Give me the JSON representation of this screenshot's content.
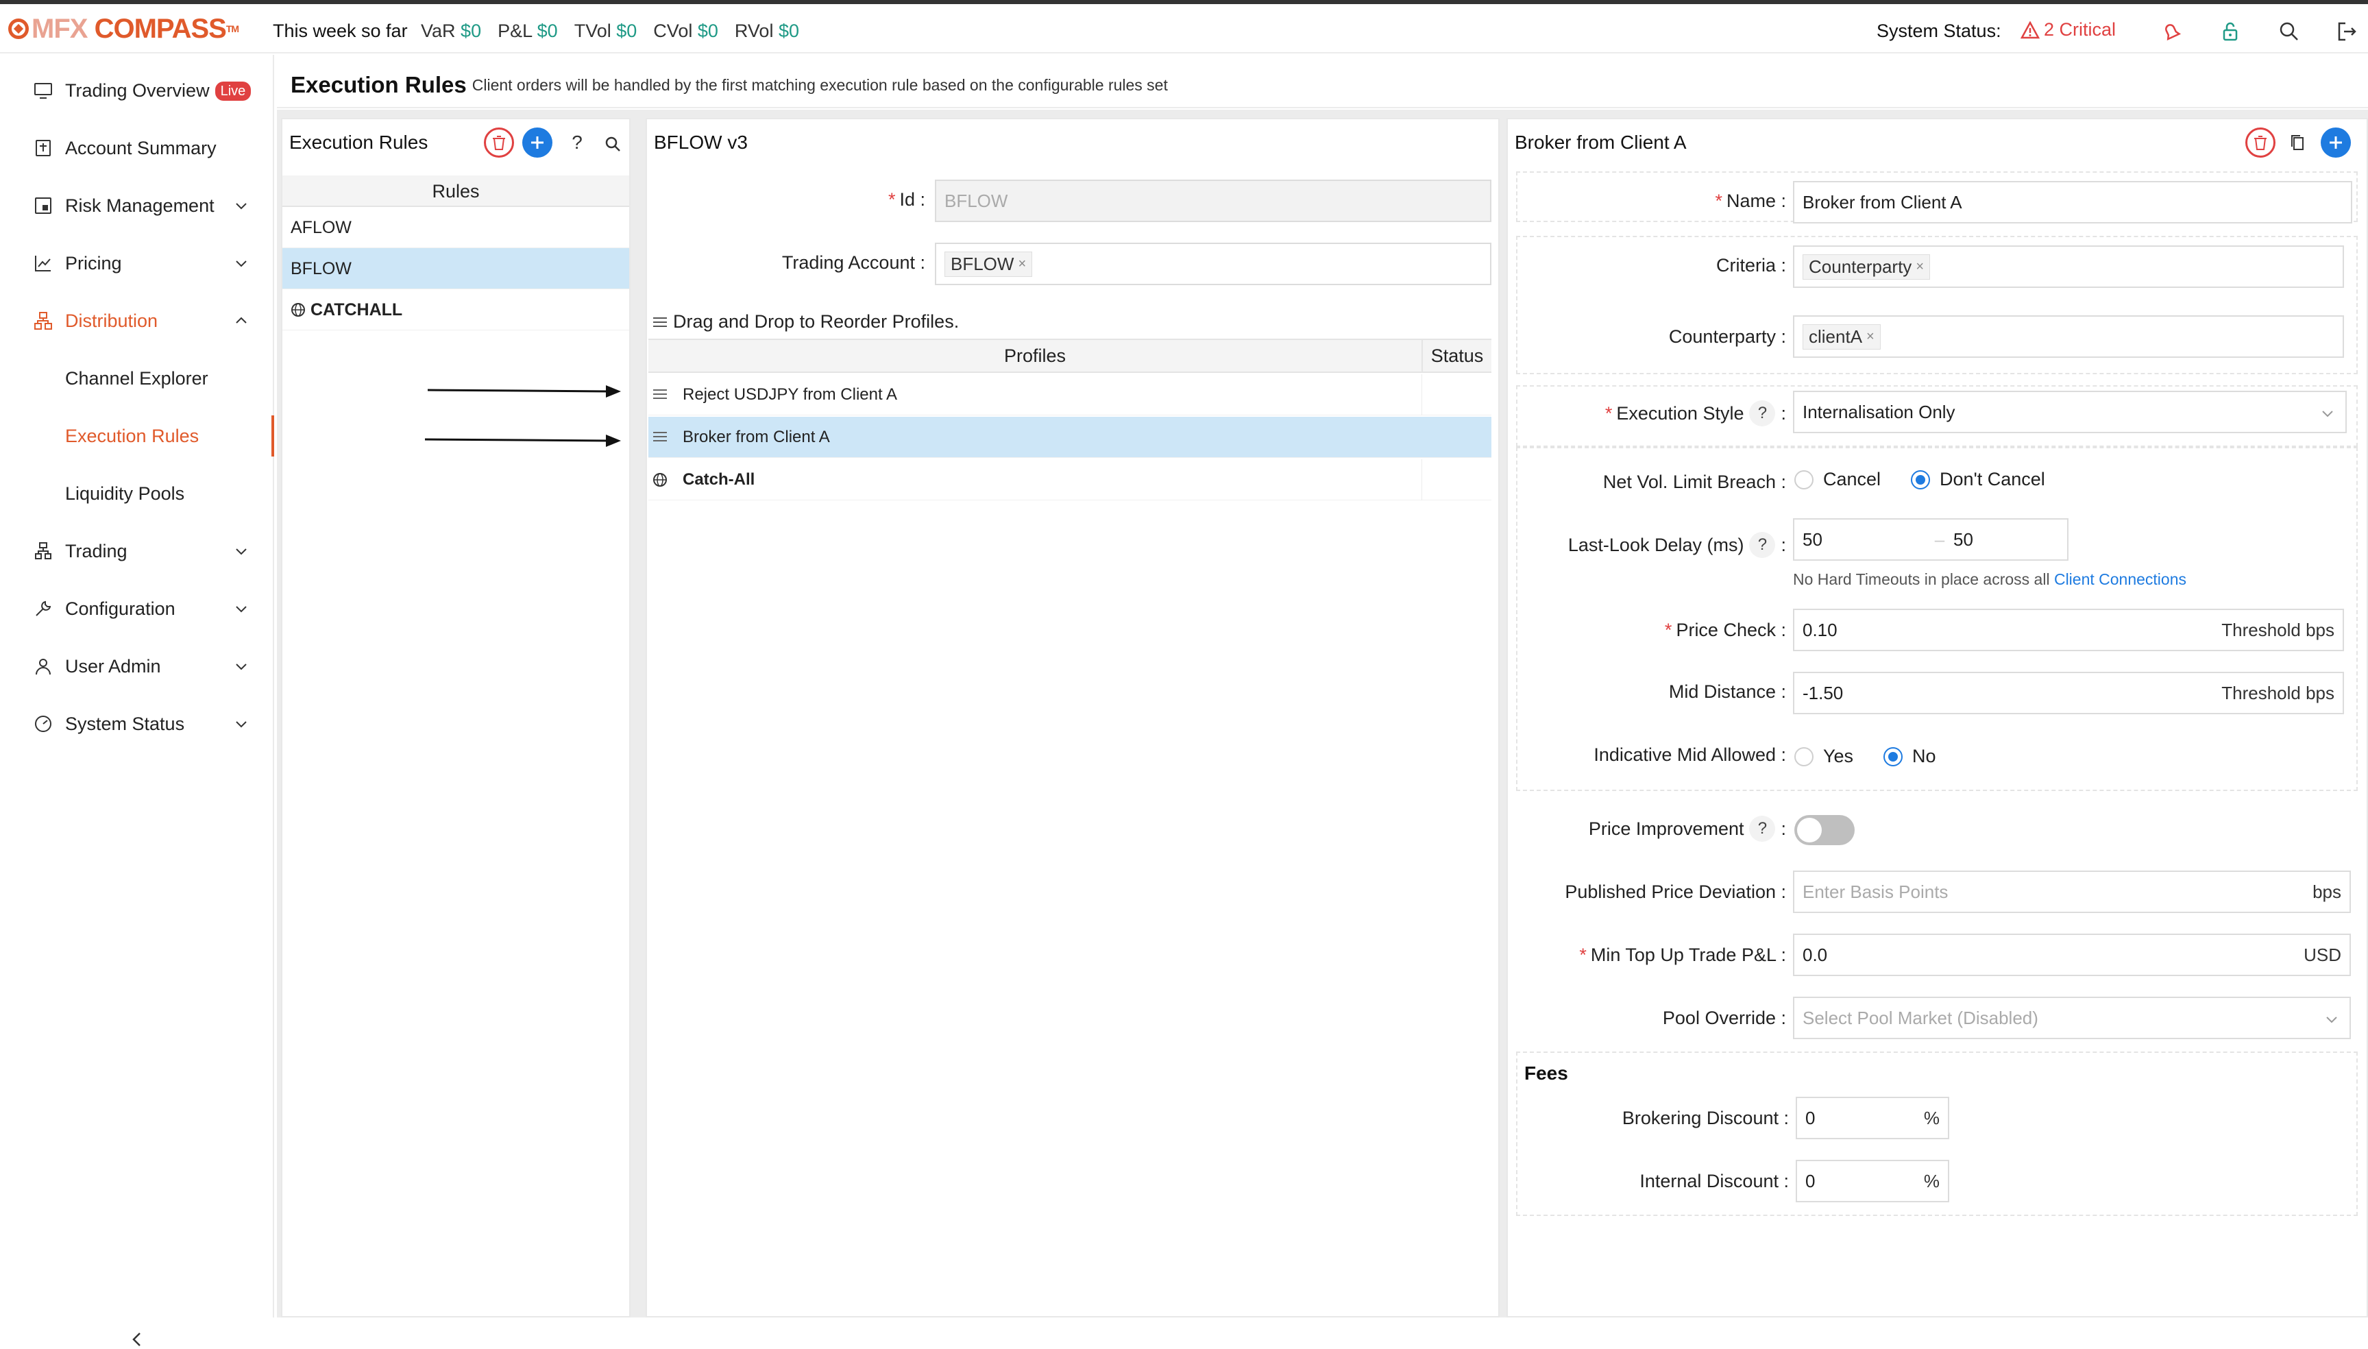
{
  "topbar": {
    "logo_mfx": "MFX",
    "logo_compass": "COMPASS",
    "logo_tm": "TM",
    "week": "This week so far",
    "metrics": [
      {
        "label": "VaR",
        "value": "$0"
      },
      {
        "label": "P&L",
        "value": "$0"
      },
      {
        "label": "TVol",
        "value": "$0"
      },
      {
        "label": "CVol",
        "value": "$0"
      },
      {
        "label": "RVol",
        "value": "$0"
      }
    ],
    "system_status_label": "System Status:",
    "critical": "2 Critical"
  },
  "sidebar": {
    "live": "Live",
    "items": [
      {
        "label": "Trading Overview"
      },
      {
        "label": "Account Summary"
      },
      {
        "label": "Risk Management"
      },
      {
        "label": "Pricing"
      },
      {
        "label": "Distribution"
      },
      {
        "label": "Channel Explorer"
      },
      {
        "label": "Execution Rules"
      },
      {
        "label": "Liquidity Pools"
      },
      {
        "label": "Trading"
      },
      {
        "label": "Configuration"
      },
      {
        "label": "User Admin"
      },
      {
        "label": "System Status"
      }
    ]
  },
  "header": {
    "title": "Execution Rules",
    "subtitle": "Client orders will be handled by the first matching execution rule based on the configurable rules set"
  },
  "rules_panel": {
    "title": "Execution Rules",
    "column": "Rules",
    "rules": [
      "AFLOW",
      "BFLOW",
      "CATCHALL"
    ]
  },
  "middle": {
    "title": "BFLOW v3",
    "id_label": "Id",
    "id_value": "BFLOW",
    "trading_account_label": "Trading Account",
    "trading_account_tag": "BFLOW",
    "drag_note": "Drag and Drop to Reorder Profiles.",
    "col_profiles": "Profiles",
    "col_status": "Status",
    "profiles": [
      "Reject USDJPY from Client A",
      "Broker from Client A",
      "Catch-All"
    ]
  },
  "right": {
    "title": "Broker from Client A",
    "name_label": "Name",
    "name_value": "Broker from Client A",
    "criteria_label": "Criteria",
    "criteria_tag": "Counterparty",
    "counterparty_label": "Counterparty",
    "counterparty_tag": "clientA",
    "exec_style_label": "Execution Style",
    "exec_style_value": "Internalisation Only",
    "net_vol_label": "Net Vol. Limit Breach",
    "opt_cancel": "Cancel",
    "opt_dont_cancel": "Don't Cancel",
    "last_look_label": "Last-Look Delay (ms)",
    "last_look_min": "50",
    "last_look_max": "50",
    "hard_timeout_note": "No Hard Timeouts in place across all",
    "client_connections": "Client Connections",
    "price_check_label": "Price Check",
    "price_check_value": "0.10",
    "threshold_bps": "Threshold bps",
    "mid_distance_label": "Mid Distance",
    "mid_distance_value": "-1.50",
    "indicative_label": "Indicative Mid Allowed",
    "opt_yes": "Yes",
    "opt_no": "No",
    "price_improvement_label": "Price Improvement",
    "ppd_label": "Published Price Deviation",
    "ppd_placeholder": "Enter Basis Points",
    "bps": "bps",
    "min_top_up_label": "Min Top Up Trade P&L",
    "min_top_up_value": "0.0",
    "usd": "USD",
    "pool_override_label": "Pool Override",
    "pool_override_placeholder": "Select Pool Market (Disabled)",
    "fees_title": "Fees",
    "brokering_discount_label": "Brokering Discount",
    "brokering_discount_value": "0",
    "internal_discount_label": "Internal Discount",
    "internal_discount_value": "0",
    "percent": "%"
  },
  "colors": {
    "accent": "#e05a2b",
    "primary": "#1e7be0",
    "positive": "#1f9a86",
    "critical": "#e04141",
    "selection": "#cde6f7"
  }
}
